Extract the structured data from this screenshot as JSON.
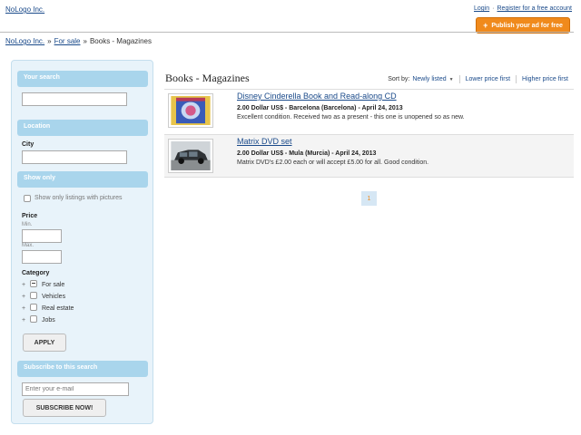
{
  "header": {
    "logo": "NoLogo Inc.",
    "login": "Login",
    "separator": "·",
    "register": "Register for a free account",
    "publish_plus": "+",
    "publish": "Publish your ad for free"
  },
  "breadcrumb": {
    "home": "NoLogo Inc.",
    "sep1": "»",
    "for_sale": "For sale",
    "sep2": "»",
    "current": "Books - Magazines"
  },
  "sidebar": {
    "search_head": "Your search",
    "search_value": "",
    "location_head": "Location",
    "city_label": "City",
    "city_value": "",
    "show_only_head": "Show only",
    "pictures_label": "Show only listings with pictures",
    "price_label": "Price",
    "min_label": "Min.",
    "max_label": "Max.",
    "category_label": "Category",
    "categories": [
      {
        "plus": "+",
        "label": "For sale"
      },
      {
        "plus": "+",
        "label": "Vehicles"
      },
      {
        "plus": "+",
        "label": "Real estate"
      },
      {
        "plus": "+",
        "label": "Jobs"
      }
    ],
    "apply": "APPLY",
    "subscribe_head": "Subscribe to this search",
    "email_placeholder": "Enter your e-mail",
    "subscribe_btn": "SUBSCRIBE NOW!"
  },
  "main": {
    "title": "Books - Magazines",
    "sort_label": "Sort by:",
    "sort_selected": "Newly listed",
    "sort_caret": "▼",
    "sort_lower": "Lower price first",
    "sort_higher": "Higher price first"
  },
  "listings": [
    {
      "title": "Disney Cinderella Book and Read-along CD",
      "meta": "2.00 Dollar US$ - Barcelona (Barcelona) - April 24, 2013",
      "desc": "Excellent condition. Received two as a present - this one is unopened so as new."
    },
    {
      "title": "Matrix DVD set",
      "meta": "2.00 Dollar US$ - Mula (Murcia) - April 24, 2013",
      "desc": "Matrix DVD's £2.00 each or will accept £5.00 for all. Good condition."
    }
  ],
  "pagination": {
    "current": "1"
  },
  "colors": {
    "accent": "#f08a1c",
    "link": "#1a4a8a",
    "sidebar_bg": "#e8f3fa",
    "sidebar_head": "#a9d5ec"
  }
}
